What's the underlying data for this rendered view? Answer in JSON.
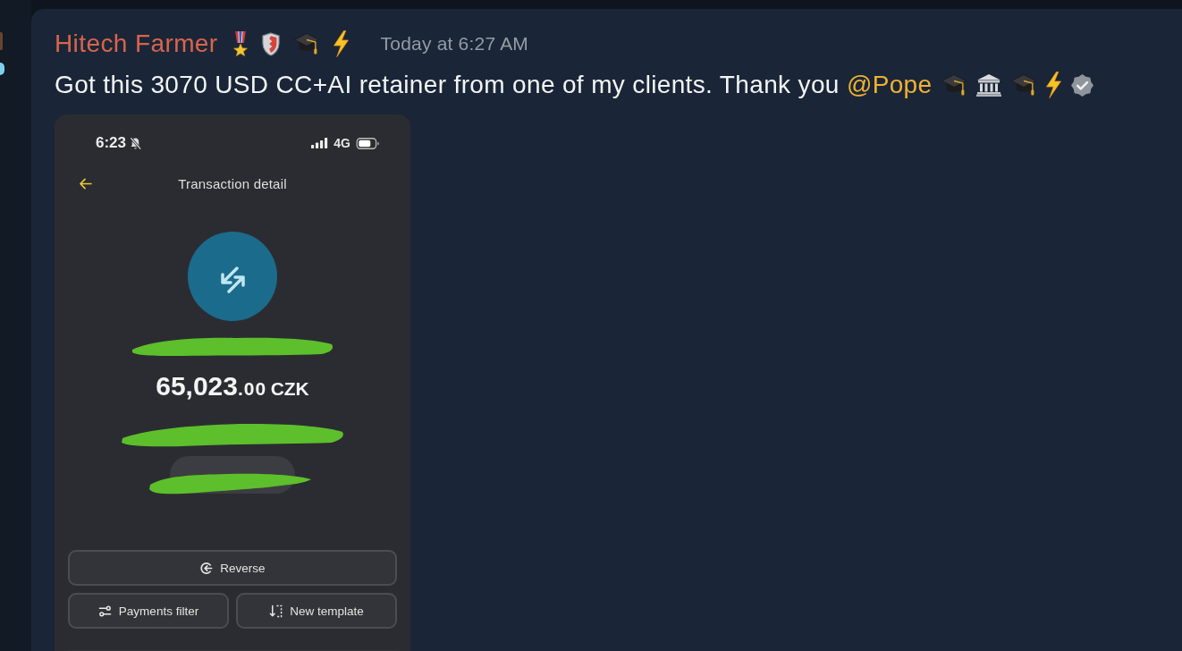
{
  "message": {
    "author": "Hitech Farmer",
    "author_badges": [
      {
        "kind": "medal"
      },
      {
        "kind": "shield"
      },
      {
        "kind": "graduation_cap"
      },
      {
        "kind": "lightning"
      }
    ],
    "timestamp": "Today at 6:27 AM",
    "text": "Got this 3070 USD CC+AI retainer from one of my clients. Thank you",
    "mention": "@Pope",
    "emojis": [
      {
        "kind": "graduation_cap"
      },
      {
        "kind": "classical_building"
      },
      {
        "kind": "graduation_cap"
      },
      {
        "kind": "lightning"
      },
      {
        "kind": "verified"
      }
    ]
  },
  "attachment": {
    "status_bar": {
      "time": "6:23",
      "network": "4G"
    },
    "title": "Transaction detail",
    "amount": {
      "whole": "65,023",
      "fraction": ".00",
      "currency": "CZK"
    },
    "buttons": [
      {
        "kind": "reverse",
        "label": "Reverse"
      },
      {
        "kind": "filter",
        "label": "Payments filter"
      },
      {
        "kind": "template",
        "label": "New template"
      }
    ]
  }
}
